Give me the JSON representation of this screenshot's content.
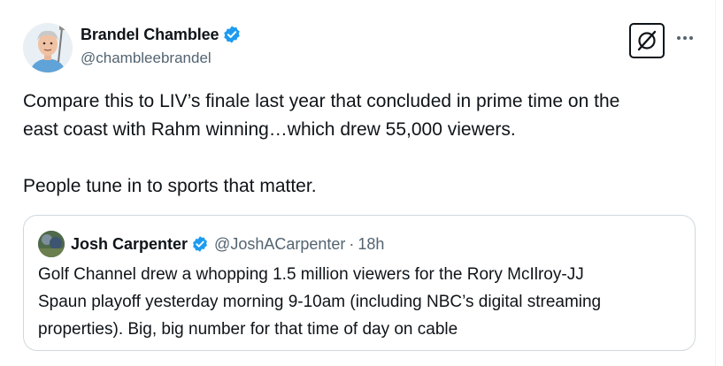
{
  "tweet": {
    "author": {
      "display_name": "Brandel Chamblee",
      "handle": "@chambleebrandel",
      "verified": true,
      "avatar_icon": "cartoon-golfer-avatar"
    },
    "actions": {
      "grok_icon": "grok-icon",
      "more_icon": "more-icon"
    },
    "text_lines": [
      "Compare this to LIV’s finale last year that concluded in prime time on the",
      "east coast with Rahm winning…which drew 55,000 viewers.",
      "",
      "People tune in to sports that matter."
    ],
    "quoted": {
      "display_name": "Josh Carpenter",
      "handle": "@JoshACarpenter",
      "separator": "·",
      "time": "18h",
      "verified": true,
      "text_lines": [
        "Golf Channel drew a whopping 1.5 million viewers for the Rory McIlroy-JJ",
        "Spaun playoff yesterday morning 9-10am (including NBC’s digital streaming",
        "properties). Big, big number for that time of day on cable"
      ]
    }
  },
  "colors": {
    "text": "#0f1419",
    "secondary": "#536471",
    "verified_blue": "#1d9bf0",
    "border": "#cfd9de"
  }
}
